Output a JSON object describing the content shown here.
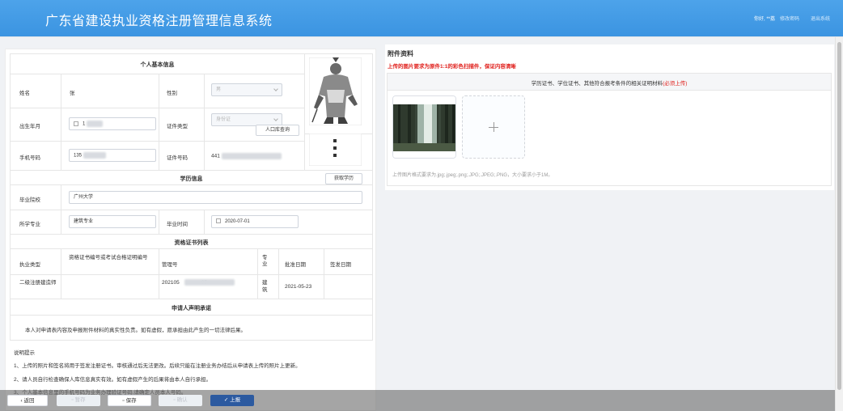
{
  "header": {
    "title": "广东省建设执业资格注册管理信息系统",
    "user": "你好, **荔",
    "change_password": "修改密码",
    "logout": "退出系统"
  },
  "personal": {
    "title": "个人基本信息",
    "name_label": "姓名",
    "name_value": "张　　",
    "gender_label": "性别",
    "gender_value": "男",
    "dob_label": "出生年月",
    "dob_value": "1",
    "id_type_label": "证件类型",
    "id_type_value": "身份证",
    "lookup_button": "人口库查询",
    "phone_label": "手机号码",
    "phone_value": "135",
    "id_number_label": "证件号码",
    "id_number_value": "441"
  },
  "education": {
    "title": "学历信息",
    "fetch_button": "获取学历",
    "school_label": "毕业院校",
    "school_value": "广州大学",
    "major_label": "所学专业",
    "major_value": "建筑专业",
    "grad_time_label": "毕业时间",
    "grad_time_value": "2020-07-01"
  },
  "certificates": {
    "title": "资格证书列表",
    "columns": [
      "执业类型",
      "资格证书编号或考试合格证明编号",
      "管理号",
      "专业",
      "批准日期",
      "签发日期"
    ],
    "rows": [
      [
        "二级注册建造师",
        "",
        "202105               95",
        "建筑",
        "2021-05-23",
        ""
      ]
    ]
  },
  "declaration": {
    "title": "申请人声明承诺",
    "text": "本人对申请表内容及申报附件材料的真实性负责。如有虚假，愿承担由此产生的一切法律后果。"
  },
  "notes": {
    "title": "说明提示",
    "items": [
      "1、上传的照片和签名将用于签发注册证书。审核通过后无法更改。后续只能在注册业务办结后从申请表上传的照片上更新。",
      "2、请人员自行检查确保人库信息真实有效。如有虚假产生的后果将由本人自行承担。",
      "3、个人基本信息里的手机号码为业务办理验证号码,请确定人员本人号码。"
    ]
  },
  "attachments": {
    "title": "附件资料",
    "warning": "上传的图片要求为原件1:1的彩色扫描件，保证内容清晰",
    "box_title": "学历证书、学位证书、其他符合报考条件的相关证明材料",
    "box_required": "(必须上传)",
    "hint": "上传图片格式要求为.jpg;.jpeg;.png;.JPG;.JPEG;.PNG，大小要求小于1M。"
  },
  "footer": {
    "back": "返回",
    "temp": "暂存",
    "save": "保存",
    "confirm": "确认",
    "submit": "上报"
  },
  "colors": {
    "header": "#3b94e1",
    "primary_button": "#2c5aa0",
    "required_red": "#e0201c"
  }
}
